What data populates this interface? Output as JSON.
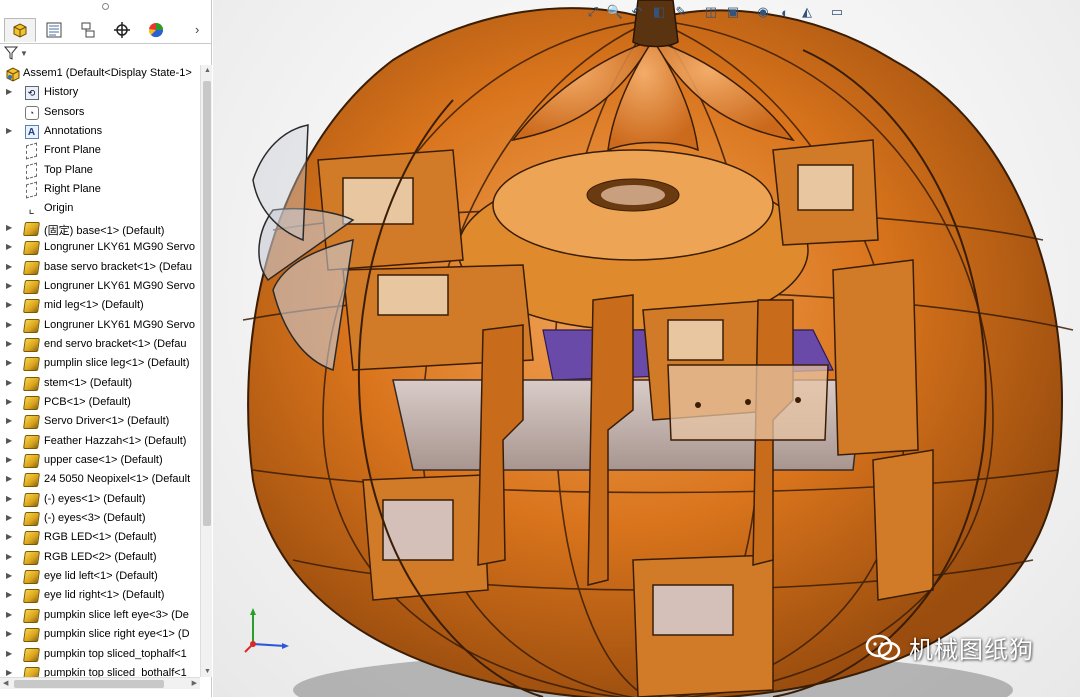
{
  "feature_tree": {
    "tabs": [
      {
        "name": "feature-manager",
        "icon": "feature-manager-icon"
      },
      {
        "name": "property-manager",
        "icon": "property-manager-icon"
      },
      {
        "name": "configuration-manager",
        "icon": "configuration-manager-icon"
      },
      {
        "name": "dimxpert-manager",
        "icon": "dimxpert-icon"
      },
      {
        "name": "display-manager",
        "icon": "display-manager-icon"
      }
    ],
    "root_label": "Assem1  (Default<Display State-1>",
    "items": [
      {
        "label": "History",
        "icon": "history-icon",
        "expandable": true
      },
      {
        "label": "Sensors",
        "icon": "sensors-icon",
        "expandable": false
      },
      {
        "label": "Annotations",
        "icon": "annotations-icon",
        "expandable": true
      },
      {
        "label": "Front Plane",
        "icon": "plane-icon",
        "expandable": false
      },
      {
        "label": "Top Plane",
        "icon": "plane-icon",
        "expandable": false
      },
      {
        "label": "Right Plane",
        "icon": "plane-icon",
        "expandable": false
      },
      {
        "label": "Origin",
        "icon": "origin-icon",
        "expandable": false
      },
      {
        "label": "(固定) base<1> (Default)",
        "icon": "part-icon",
        "expandable": true
      },
      {
        "label": "Longruner LKY61 MG90 Servo",
        "icon": "part-icon",
        "expandable": true
      },
      {
        "label": "base servo bracket<1> (Defau",
        "icon": "part-icon",
        "expandable": true
      },
      {
        "label": "Longruner LKY61 MG90 Servo",
        "icon": "part-icon",
        "expandable": true
      },
      {
        "label": "mid leg<1> (Default)",
        "icon": "part-icon",
        "expandable": true
      },
      {
        "label": "Longruner LKY61 MG90 Servo",
        "icon": "part-icon",
        "expandable": true
      },
      {
        "label": "end servo bracket<1> (Defau",
        "icon": "part-icon",
        "expandable": true
      },
      {
        "label": "pumplin slice leg<1> (Default)",
        "icon": "part-icon",
        "expandable": true
      },
      {
        "label": "stem<1> (Default)",
        "icon": "part-icon",
        "expandable": true
      },
      {
        "label": "PCB<1> (Default)",
        "icon": "part-icon",
        "expandable": true
      },
      {
        "label": "Servo Driver<1> (Default)",
        "icon": "part-icon",
        "expandable": true
      },
      {
        "label": "Feather Hazzah<1> (Default)",
        "icon": "part-icon",
        "expandable": true
      },
      {
        "label": "upper case<1> (Default)",
        "icon": "part-icon",
        "expandable": true
      },
      {
        "label": "24 5050 Neopixel<1> (Default",
        "icon": "part-icon",
        "expandable": true
      },
      {
        "label": "(-) eyes<1> (Default)",
        "icon": "part-icon",
        "expandable": true
      },
      {
        "label": "(-) eyes<3> (Default)",
        "icon": "part-icon",
        "expandable": true
      },
      {
        "label": "RGB LED<1> (Default)",
        "icon": "part-icon",
        "expandable": true
      },
      {
        "label": "RGB LED<2> (Default)",
        "icon": "part-icon",
        "expandable": true
      },
      {
        "label": "eye lid left<1> (Default)",
        "icon": "part-icon",
        "expandable": true
      },
      {
        "label": "eye lid right<1> (Default)",
        "icon": "part-icon",
        "expandable": true
      },
      {
        "label": "pumpkin slice left eye<3> (De",
        "icon": "part-icon",
        "expandable": true
      },
      {
        "label": "pumpkin slice right eye<1> (D",
        "icon": "part-icon",
        "expandable": true
      },
      {
        "label": "pumpkin top sliced_tophalf<1",
        "icon": "part-icon",
        "expandable": true
      },
      {
        "label": "pumpkin top sliced_bothalf<1",
        "icon": "part-icon",
        "expandable": true
      }
    ]
  },
  "heads_up_toolbar": [
    "zoom-to-fit-icon",
    "zoom-area-icon",
    "previous-view-icon",
    "section-view-icon",
    "dynamic-annotation-icon",
    "view-orientation-icon",
    "display-style-icon",
    "hide-show-icon",
    "edit-appearance-icon",
    "apply-scene-icon",
    "view-settings-icon"
  ],
  "colors": {
    "pumpkin": "#d9741c",
    "pumpkin_dark": "#9a4d0e",
    "outline": "#3a1d05",
    "accent_blue": "#34537a"
  },
  "watermark": {
    "text": "机械图纸狗"
  }
}
